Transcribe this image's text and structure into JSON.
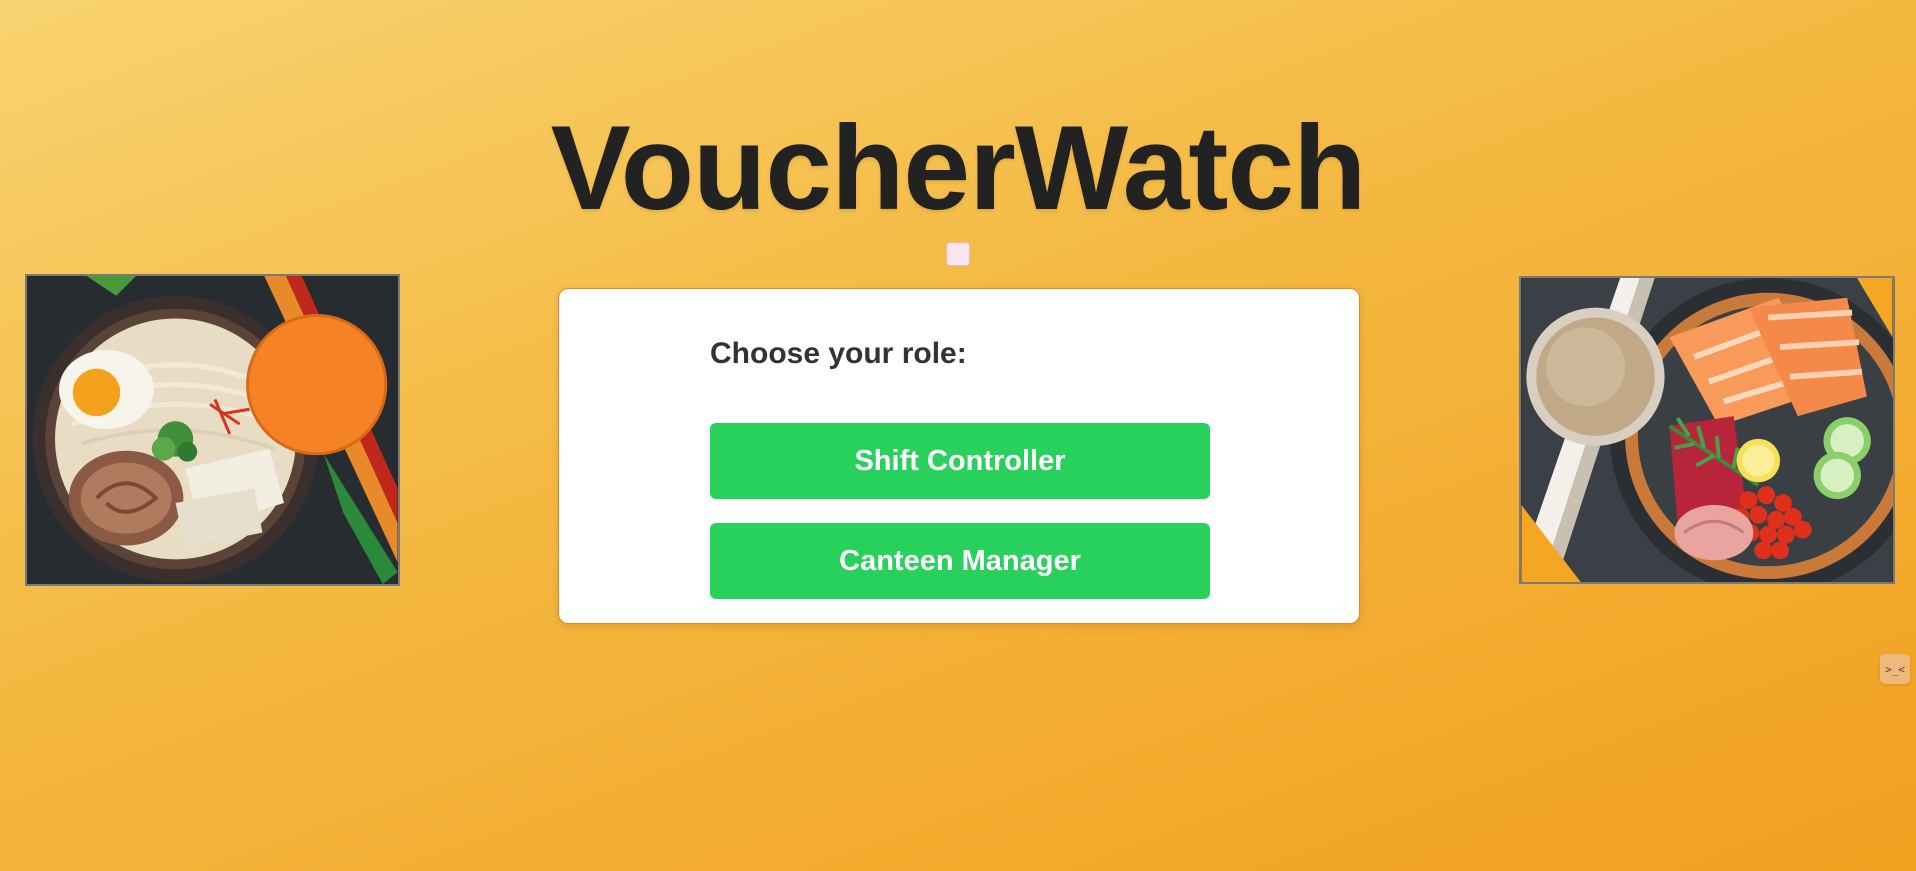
{
  "app": {
    "title": "VoucherWatch"
  },
  "role_card": {
    "prompt": "Choose your role:",
    "buttons": [
      {
        "label": "Shift Controller"
      },
      {
        "label": "Canteen Manager"
      }
    ]
  },
  "images": {
    "left": "ramen-bowl-illustration",
    "right": "salmon-sashimi-bowl-illustration"
  },
  "widget": {
    "icon": "sleepy-face-icon",
    "glyph": ">_<"
  },
  "colors": {
    "background_top": "#f8d370",
    "background_bottom": "#f2a020",
    "button": "#28d05c",
    "card_border": "#e2862a",
    "title": "#222222"
  }
}
